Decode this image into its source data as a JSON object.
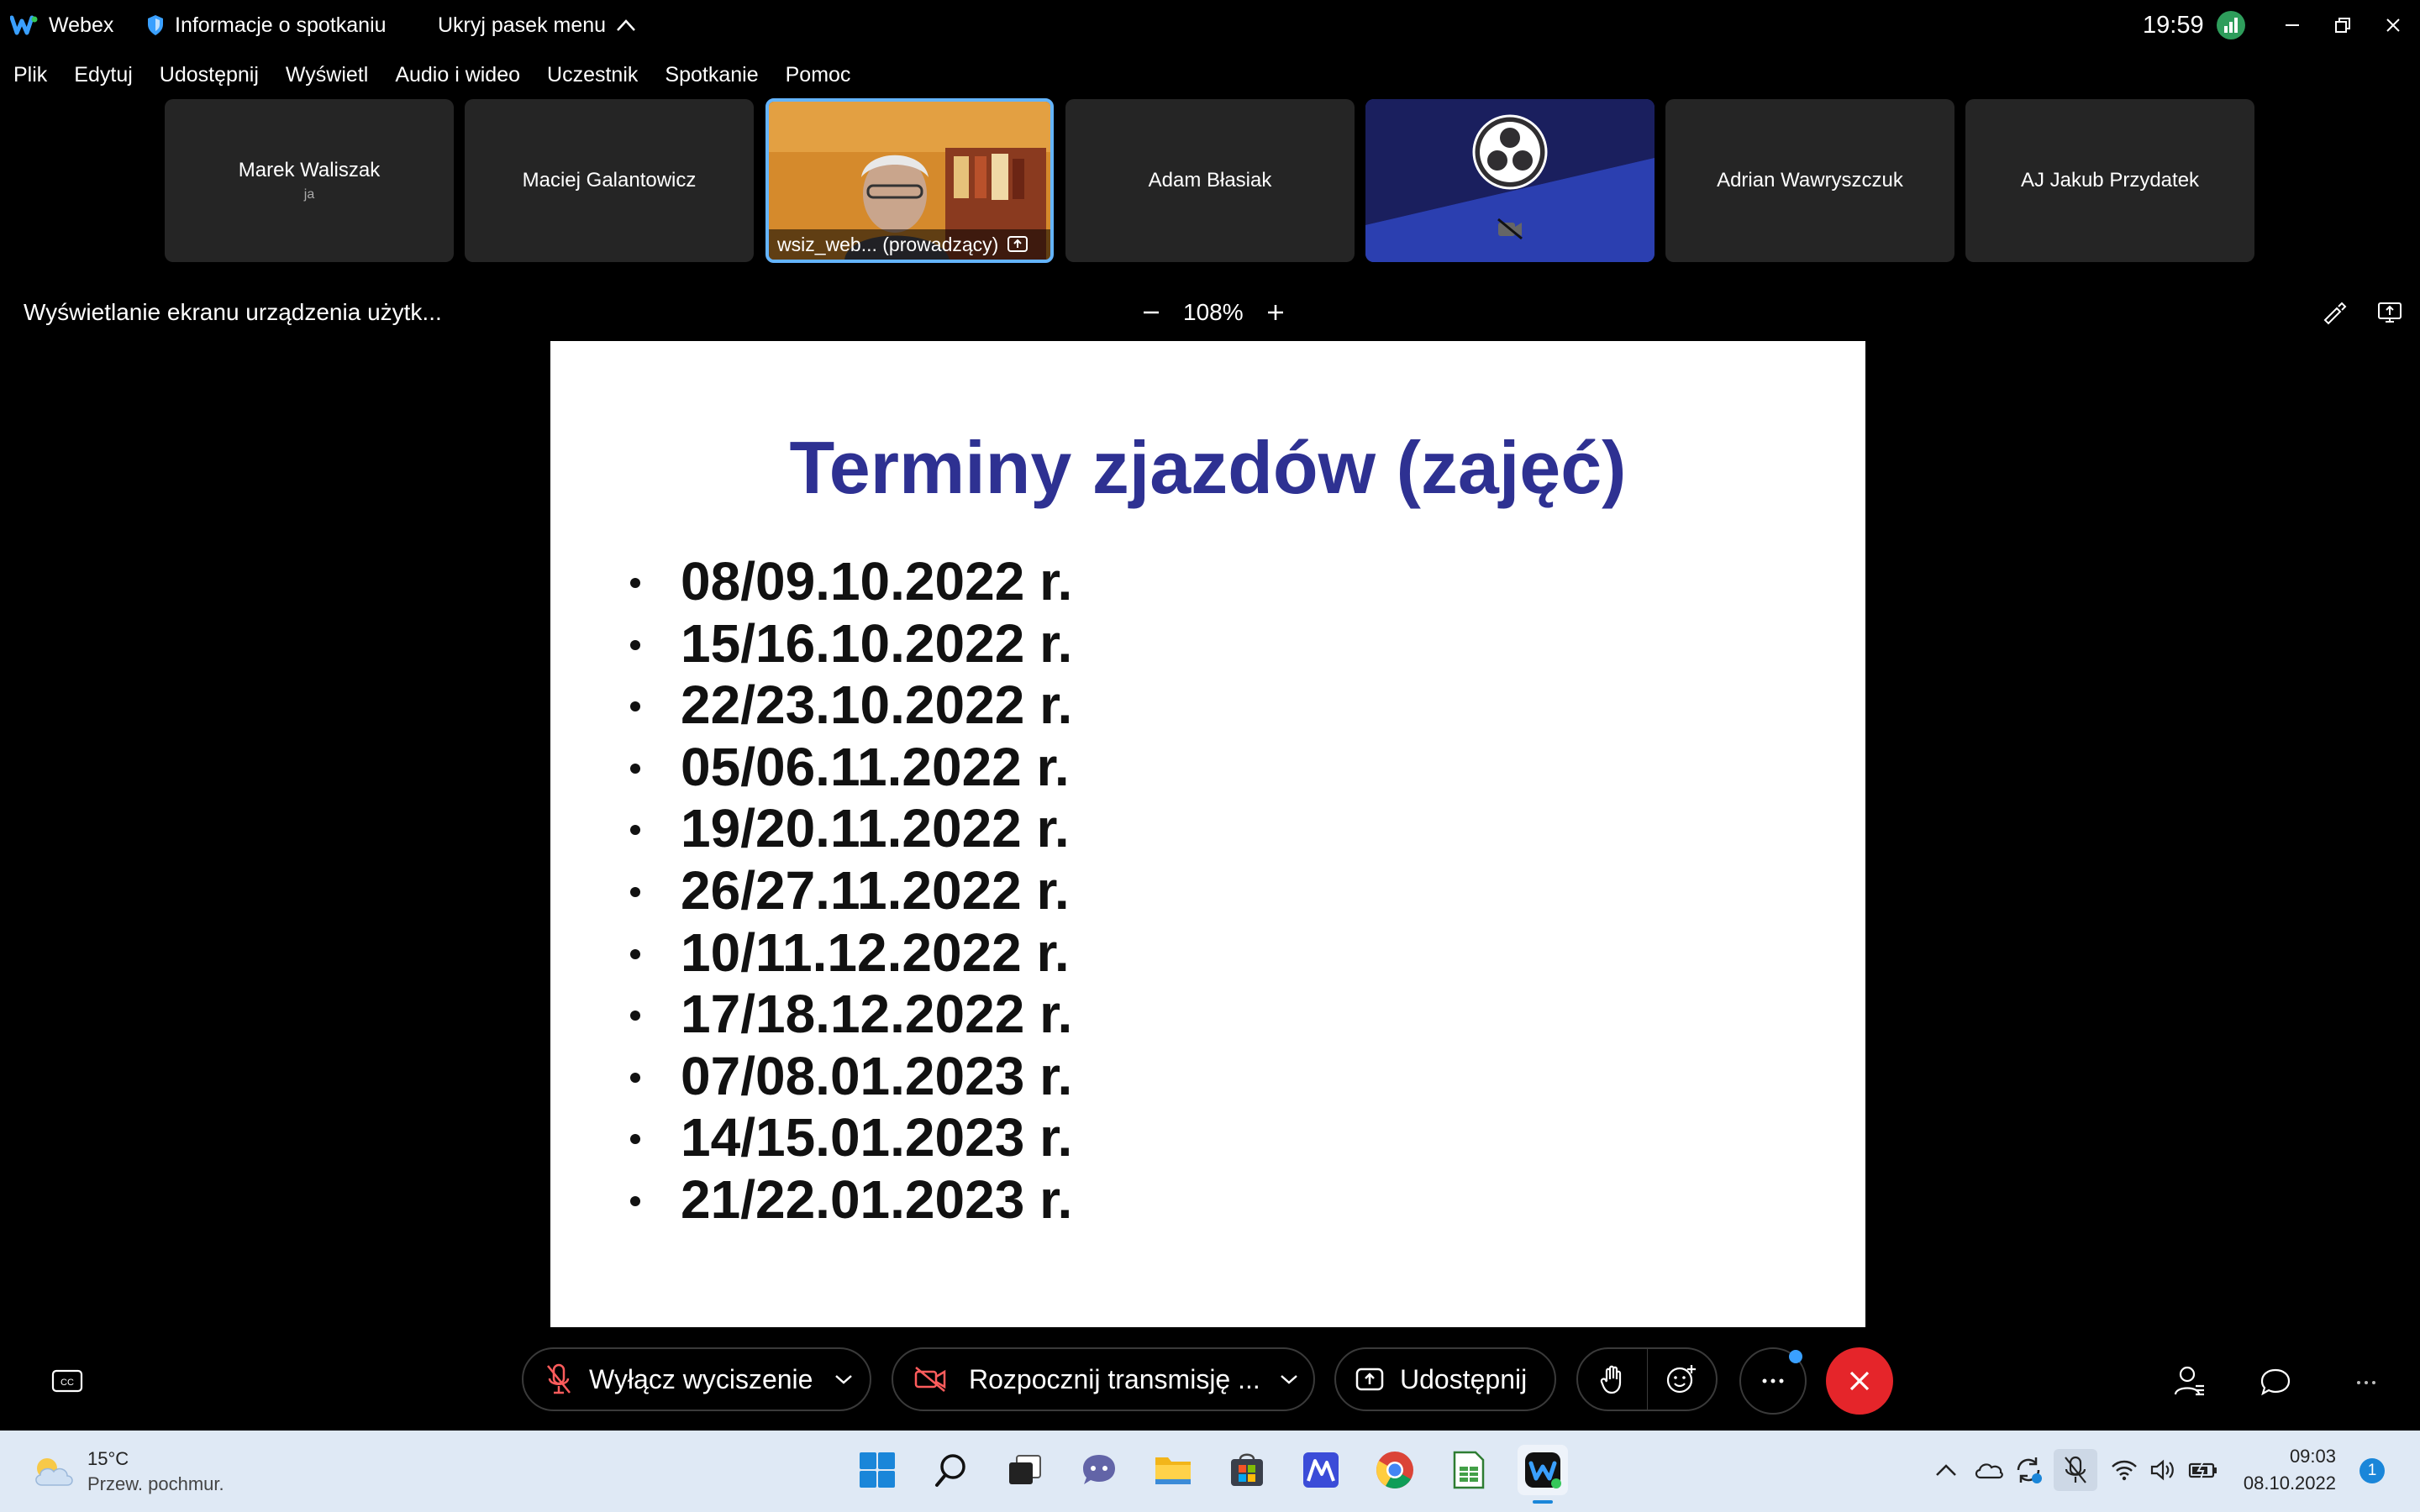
{
  "titlebar": {
    "app_name": "Webex",
    "meeting_info": "Informacje o spotkaniu",
    "hide_menu": "Ukryj pasek menu",
    "clock": "19:59"
  },
  "menu": [
    "Plik",
    "Edytuj",
    "Udostępnij",
    "Wyświetl",
    "Audio i wideo",
    "Uczestnik",
    "Spotkanie",
    "Pomoc"
  ],
  "participants": [
    {
      "name": "Marek Waliszak",
      "sub": "ja"
    },
    {
      "name": "Maciej Galantowicz",
      "sub": ""
    },
    {
      "name": "wsiz_web... (prowadzący)",
      "sub": "",
      "active": true
    },
    {
      "name": "Adam Błasiak",
      "sub": ""
    },
    {
      "name": "",
      "sub": ""
    },
    {
      "name": "Adrian Wawryszczuk",
      "sub": ""
    },
    {
      "name": "AJ Jakub Przydatek",
      "sub": ""
    }
  ],
  "share": {
    "title": "Wyświetlanie ekranu urządzenia użytk...",
    "zoom": "108%"
  },
  "slide": {
    "title": "Terminy zjazdów (zajęć)",
    "items": [
      "08/09.10.2022 r.",
      "15/16.10.2022 r.",
      "22/23.10.2022 r.",
      "05/06.11.2022 r.",
      "19/20.11.2022 r.",
      "26/27.11.2022 r.",
      "10/11.12.2022 r.",
      "17/18.12.2022 r.",
      "07/08.01.2023 r.",
      "14/15.01.2023 r.",
      "21/22.01.2023 r."
    ]
  },
  "controls": {
    "unmute": "Wyłącz wyciszenie",
    "start_video": "Rozpocznij transmisję ...",
    "share": "Udostępnij"
  },
  "taskbar": {
    "weather_temp": "15°C",
    "weather_desc": "Przew. pochmur.",
    "time": "09:03",
    "date": "08.10.2022",
    "notification_count": "1"
  },
  "colors": {
    "slide_title": "#2e3192",
    "end_call": "#e5252a",
    "active_tile_border": "#64b4ff"
  }
}
